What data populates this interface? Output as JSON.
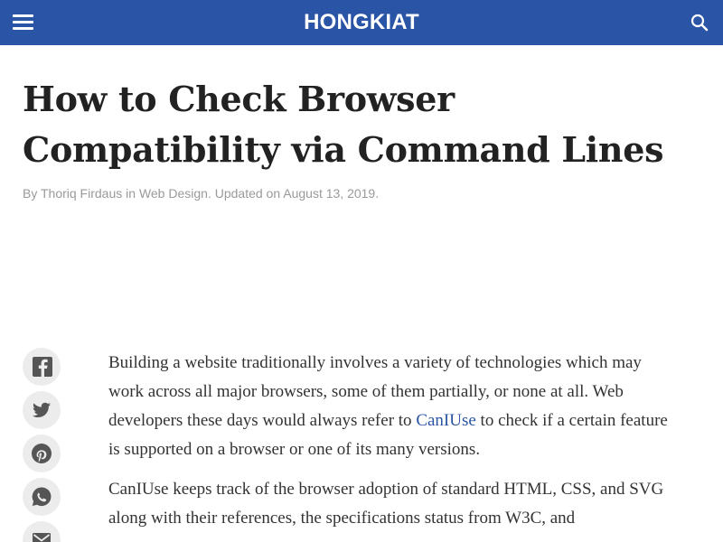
{
  "header": {
    "menu_icon": "hamburger-menu-icon",
    "logo": "HONGKIAT",
    "search_icon": "search-icon",
    "colors": {
      "background": "#2a54a5",
      "text": "#ffffff"
    }
  },
  "article": {
    "title": "How to Check Browser Compatibility via Command Lines",
    "byline": {
      "prefix": "By",
      "author": "Thoriq Firdaus",
      "in_text": "in",
      "category": "Web Design",
      "updated": ". Updated on August 13, 2019."
    },
    "paragraph1": {
      "text_before": "Building a website traditionally involves a variety of technologies which may work across all major browsers, some of them partially, or none at all. Web developers these days would always refer to",
      "link": "CanIUse",
      "text_after": "to check if a certain feature is supported on a browser or one of its many versions."
    },
    "paragraph2": {
      "text": "CanIUse keeps track of the browser adoption of standard HTML, CSS, and SVG along with their references, the specifications status from W3C, and"
    }
  },
  "share": [
    {
      "name": "facebook",
      "icon": "facebook-icon"
    },
    {
      "name": "twitter",
      "icon": "twitter-icon"
    },
    {
      "name": "pinterest",
      "icon": "pinterest-icon"
    },
    {
      "name": "whatsapp",
      "icon": "whatsapp-icon"
    },
    {
      "name": "email",
      "icon": "email-icon"
    }
  ],
  "colors": {
    "title": "#222222",
    "byline": "#9a9a9a",
    "body_text": "#333333",
    "link": "#2a54a5",
    "share_bg": "#ececec",
    "share_icon": "#555555"
  }
}
